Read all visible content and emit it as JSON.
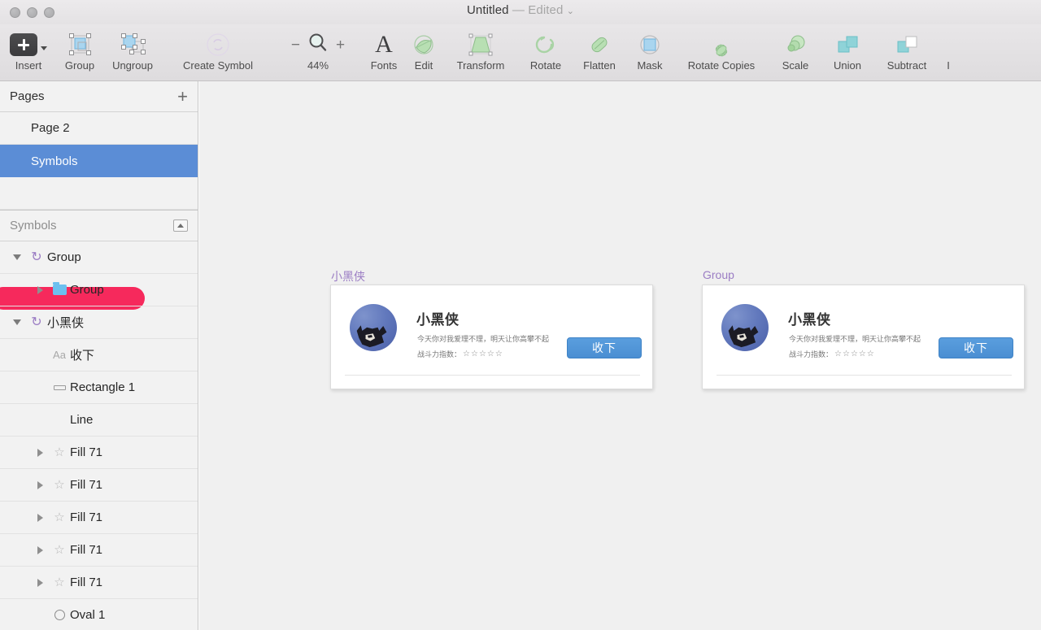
{
  "window": {
    "title": "Untitled",
    "dash": "—",
    "edited": "Edited",
    "caret": "⌄"
  },
  "toolbar": {
    "items": [
      {
        "label": "Insert",
        "icon": "insert-plus-icon"
      },
      {
        "label": "Group",
        "icon": "group-icon"
      },
      {
        "label": "Ungroup",
        "icon": "ungroup-icon"
      },
      {
        "label": "Create Symbol",
        "icon": "create-symbol-icon"
      },
      {
        "label": "44%",
        "icon": "zoom-magnifier-icon",
        "minus": "−",
        "plus": "+"
      },
      {
        "label": "Fonts",
        "icon": "fonts-a-icon"
      },
      {
        "label": "Edit",
        "icon": "edit-icon"
      },
      {
        "label": "Transform",
        "icon": "transform-icon"
      },
      {
        "label": "Rotate",
        "icon": "rotate-icon"
      },
      {
        "label": "Flatten",
        "icon": "flatten-icon"
      },
      {
        "label": "Mask",
        "icon": "mask-icon"
      },
      {
        "label": "Rotate Copies",
        "icon": "rotate-copies-icon"
      },
      {
        "label": "Scale",
        "icon": "scale-icon"
      },
      {
        "label": "Union",
        "icon": "union-icon"
      },
      {
        "label": "Subtract",
        "icon": "subtract-icon"
      },
      {
        "label": "I",
        "icon": "intersect-icon"
      }
    ]
  },
  "sidebar": {
    "pages_panel": {
      "title": "Pages",
      "add_label": "+",
      "items": [
        {
          "label": "Page 2",
          "selected": false
        },
        {
          "label": "Symbols",
          "selected": true
        },
        {
          "label": "",
          "selected": false,
          "redacted": true
        }
      ]
    },
    "symbols_panel": {
      "title": "Symbols",
      "layers": [
        {
          "label": "Group",
          "icon": "symbol-icon",
          "disclosure": "down",
          "indent": 0
        },
        {
          "label": "Group",
          "icon": "folder-icon",
          "disclosure": "right",
          "indent": 1
        },
        {
          "label": "小黑侠",
          "icon": "symbol-icon",
          "disclosure": "down",
          "indent": 0
        },
        {
          "label": "收下",
          "icon": "text-icon",
          "disclosure": "none",
          "indent": 1
        },
        {
          "label": "Rectangle 1",
          "icon": "rectangle-icon",
          "disclosure": "none",
          "indent": 1
        },
        {
          "label": "Line",
          "icon": "none",
          "disclosure": "none",
          "indent": 1
        },
        {
          "label": "Fill 71",
          "icon": "star-icon",
          "disclosure": "right",
          "indent": 1
        },
        {
          "label": "Fill 71",
          "icon": "star-icon",
          "disclosure": "right",
          "indent": 1
        },
        {
          "label": "Fill 71",
          "icon": "star-icon",
          "disclosure": "right",
          "indent": 1
        },
        {
          "label": "Fill 71",
          "icon": "star-icon",
          "disclosure": "right",
          "indent": 1
        },
        {
          "label": "Fill 71",
          "icon": "star-icon",
          "disclosure": "right",
          "indent": 1
        },
        {
          "label": "Oval 1",
          "icon": "oval-icon",
          "disclosure": "none",
          "indent": 1
        }
      ]
    }
  },
  "canvas": {
    "artboards": [
      {
        "label": "小黑侠",
        "card": {
          "name": "小黑侠",
          "description": "今天你对我爱理不理，明天让你高攀不起",
          "rating_label": "战斗力指数：",
          "stars": "☆☆☆☆☆",
          "button_label": "收下",
          "avatar": "batman-avatar"
        }
      },
      {
        "label": "Group",
        "card": {
          "name": "小黑侠",
          "description": "今天你对我爱理不理，明天让你高攀不起",
          "rating_label": "战斗力指数：",
          "stars": "☆☆☆☆☆",
          "button_label": "收下",
          "avatar": "batman-avatar"
        }
      }
    ]
  },
  "colors": {
    "selection_blue": "#5b8dd6",
    "redaction_pink": "#f6295c",
    "symbol_purple": "#9b7dc4",
    "button_blue": "#4a8ed2",
    "canvas_bg": "#f0f0f0"
  }
}
